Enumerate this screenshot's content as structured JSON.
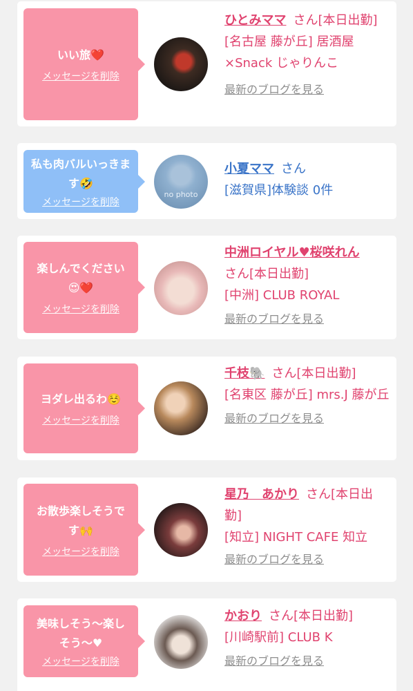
{
  "delete_label": "メッセージを削除",
  "blog_label": "最新のブログを見る",
  "san_suffix": "さん",
  "items": [
    {
      "message": "いい旅❤️",
      "name": "ひとみママ",
      "status": "[本日出勤]",
      "shop": "[名古屋 藤が丘] 居酒屋×Snack じゃりんこ",
      "has_blog": true
    },
    {
      "message": "私も肉バルいっきます🤣",
      "name": "小夏ママ",
      "status": "",
      "shop": "[滋賀県]体験談 0件",
      "avatar_text": "no photo",
      "has_blog": false
    },
    {
      "message": "楽しんでください😍❤️",
      "name": "中洲ロイヤル♥桜咲れん",
      "status": "[本日出勤]",
      "shop": "[中洲] CLUB ROYAL",
      "has_blog": true
    },
    {
      "message": "ヨダレ出るわ☺️",
      "name": "千枝🐘",
      "status": "[本日出勤]",
      "shop": "[名東区 藤が丘] mrs.J 藤が丘",
      "has_blog": true
    },
    {
      "message": "お散歩楽しそうです🙌",
      "name": "星乃　あかり",
      "status": "[本日出勤]",
      "shop": "[知立] NIGHT CAFE 知立",
      "has_blog": true
    },
    {
      "message": "美味しそう〜楽しそう〜♥",
      "name": "かおり",
      "status": "[本日出勤]",
      "shop": "[川崎駅前] CLUB K",
      "has_blog": true
    }
  ],
  "colors": {
    "pink_bubble": "#f995a8",
    "blue_bubble": "#8fbff7",
    "pink_text": "#e0436f",
    "blue_text": "#3a74c8",
    "blog_text": "#8e8e8e"
  }
}
